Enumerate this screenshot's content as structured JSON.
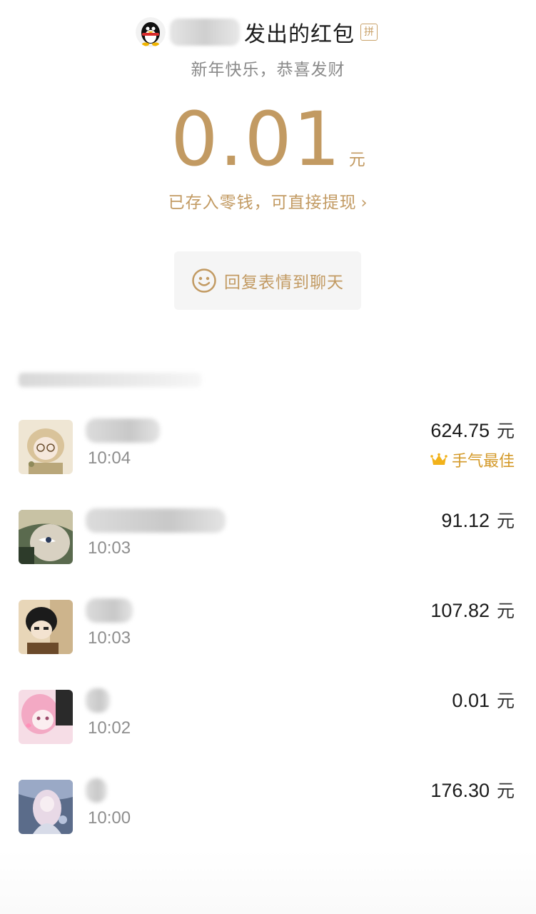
{
  "header": {
    "avatar_icon": "penguin-avatar",
    "title": "发出的红包",
    "badge": "拼",
    "greeting": "新年快乐，恭喜发财",
    "amount": "0.01",
    "amount_unit": "元",
    "wallet_link": "已存入零钱，可直接提现",
    "wallet_link_chevron": "›",
    "reply_button_label": "回复表情到聊天",
    "reply_icon": "smile-icon"
  },
  "colors": {
    "accent_gold": "#c29a62",
    "best_luck": "#d49a2a",
    "time_gray": "#8e8e8e"
  },
  "claims": [
    {
      "time": "10:04",
      "amount": "624.75",
      "unit": "元",
      "best_luck_label": "手气最佳"
    },
    {
      "time": "10:03",
      "amount": "91.12",
      "unit": "元"
    },
    {
      "time": "10:03",
      "amount": "107.82",
      "unit": "元"
    },
    {
      "time": "10:02",
      "amount": "0.01",
      "unit": "元"
    },
    {
      "time": "10:00",
      "amount": "176.30",
      "unit": "元"
    }
  ]
}
